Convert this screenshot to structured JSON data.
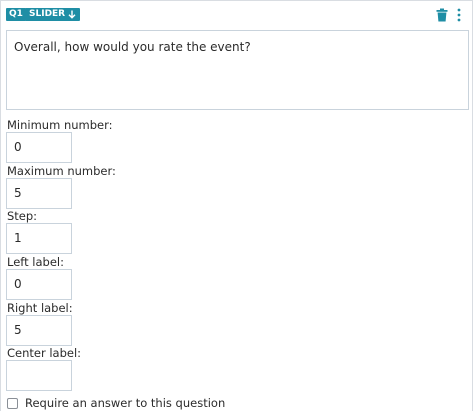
{
  "header": {
    "question_number": "Q1",
    "question_type": "SLIDER",
    "icons": [
      "arrow-down-icon",
      "trash-icon",
      "more-vertical-icon"
    ],
    "accent_color": "#1f8ea5"
  },
  "question": {
    "text": "Overall, how would you rate the event?"
  },
  "fields": {
    "minimum": {
      "label": "Minimum number:",
      "value": "0"
    },
    "maximum": {
      "label": "Maximum number:",
      "value": "5"
    },
    "step": {
      "label": "Step:",
      "value": "1"
    },
    "left_label": {
      "label": "Left label:",
      "value": "0"
    },
    "right_label": {
      "label": "Right label:",
      "value": "5"
    },
    "center_label": {
      "label": "Center label:",
      "value": ""
    }
  },
  "require": {
    "label": "Require an answer to this question",
    "checked": false
  }
}
